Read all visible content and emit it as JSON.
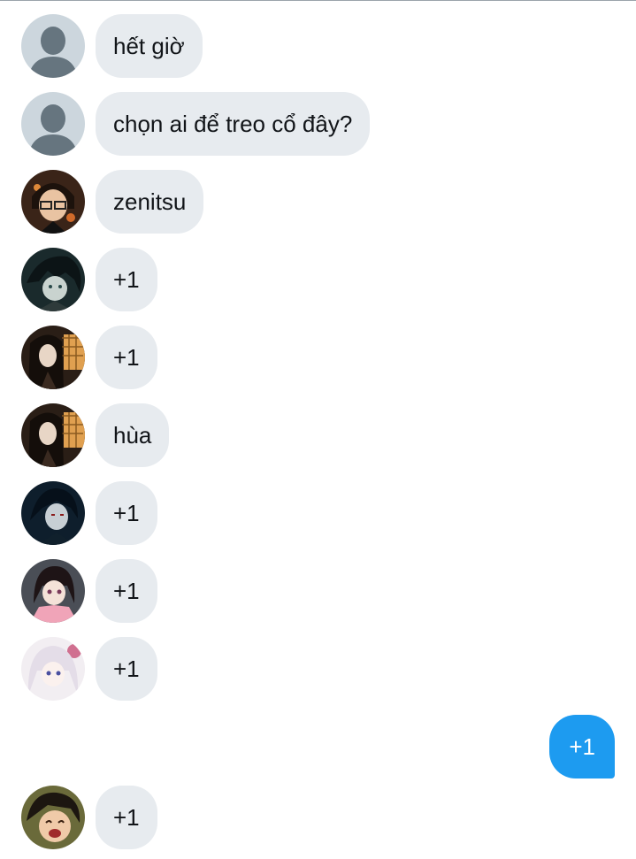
{
  "colors": {
    "incoming_bubble": "#e7ebef",
    "outgoing_bubble": "#1d9bf0",
    "text": "#111418"
  },
  "messages": [
    {
      "text": "hết giờ",
      "avatar": "default-avatar-icon"
    },
    {
      "text": "chọn ai để treo cổ đây?",
      "avatar": "default-avatar-icon"
    },
    {
      "text": "zenitsu",
      "avatar": "anime-avatar-glasses"
    },
    {
      "text": "+1",
      "avatar": "anime-avatar-dark-hair"
    },
    {
      "text": "+1",
      "avatar": "anime-avatar-long-hair"
    },
    {
      "text": "hùa",
      "avatar": "anime-avatar-long-hair"
    },
    {
      "text": "+1",
      "avatar": "anime-avatar-night"
    },
    {
      "text": "+1",
      "avatar": "anime-avatar-pink-kimono"
    },
    {
      "text": "+1",
      "avatar": "anime-avatar-white-hair"
    }
  ],
  "sent": {
    "text": "+1"
  },
  "last": {
    "text": "+1",
    "avatar": "anime-avatar-laughing"
  }
}
